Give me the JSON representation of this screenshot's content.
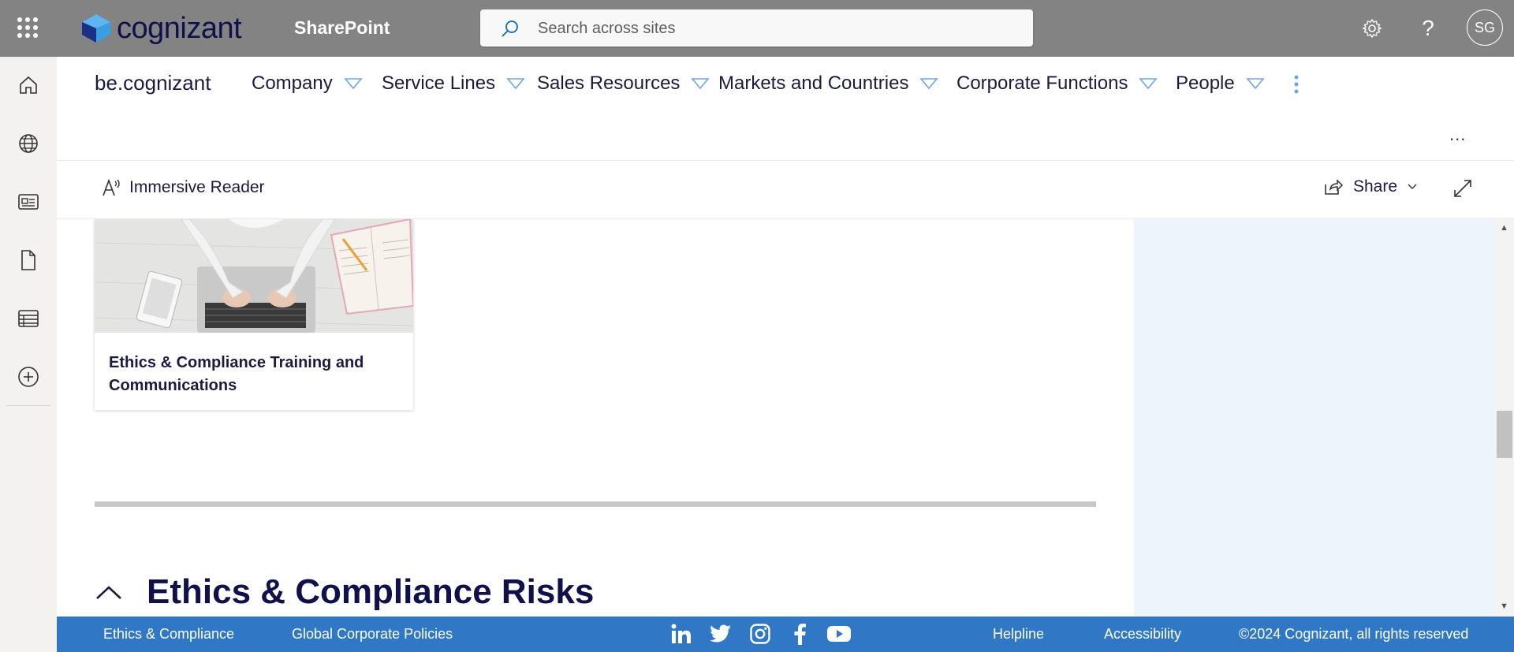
{
  "suite_bar": {
    "brand": "cognizant",
    "app_title": "SharePoint",
    "search_placeholder": "Search across sites",
    "avatar_initials": "SG"
  },
  "site_nav": {
    "site_title": "be.cognizant",
    "items": [
      {
        "label": "Company"
      },
      {
        "label": "Service Lines"
      },
      {
        "label": "Sales Resources"
      },
      {
        "label": "Markets and Countries"
      },
      {
        "label": "Corporate Functions"
      },
      {
        "label": "People"
      }
    ],
    "more": "..."
  },
  "command_bar": {
    "immersive_reader": "Immersive Reader",
    "share": "Share"
  },
  "main": {
    "card_title": "Ethics & Compliance Training and Communications",
    "section_title": "Ethics & Compliance Risks"
  },
  "footer": {
    "links_left": [
      "Ethics & Compliance",
      "Global Corporate Policies"
    ],
    "social_icons": [
      "linkedin-icon",
      "twitter-icon",
      "instagram-icon",
      "facebook-icon",
      "youtube-icon"
    ],
    "helpline": "Helpline",
    "accessibility": "Accessibility",
    "copyright": "©2024 Cognizant, all rights reserved"
  },
  "colors": {
    "suite_bar": "#838383",
    "footer": "#3078c5",
    "right_panel": "#eef4fc",
    "heading": "#10104a"
  }
}
